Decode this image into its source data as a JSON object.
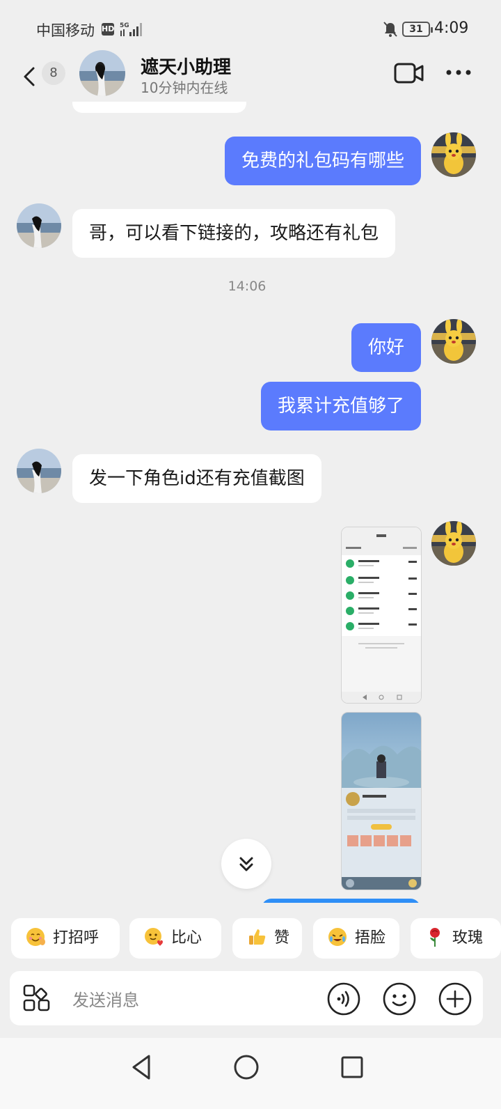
{
  "status_bar": {
    "carrier": "中国移动",
    "hd": "HD",
    "network": "5G",
    "battery": "31",
    "time": "4:09"
  },
  "header": {
    "unread_count": "8",
    "name": "遮天小助理",
    "online_status": "10分钟内在线"
  },
  "messages": [
    {
      "side": "out",
      "text": "免费的礼包码有哪些"
    },
    {
      "side": "in",
      "text": "哥，可以看下链接的，攻略还有礼包"
    },
    {
      "timestamp": "14:06"
    },
    {
      "side": "out",
      "text": "你好"
    },
    {
      "side": "out",
      "text": "我累计充值够了"
    },
    {
      "side": "in",
      "text": "发一下角色id还有充值截图"
    },
    {
      "side": "out",
      "type": "image",
      "content": "payment-records-screenshot"
    },
    {
      "side": "out",
      "type": "image",
      "content": "game-character-screenshot"
    }
  ],
  "quick_replies": [
    {
      "label": "打招呼",
      "icon": "greeting-emoji-icon"
    },
    {
      "label": "比心",
      "icon": "heart-hands-emoji-icon"
    },
    {
      "label": "赞",
      "icon": "thumbs-up-emoji-icon"
    },
    {
      "label": "捂脸",
      "icon": "facepalm-emoji-icon"
    },
    {
      "label": "玫瑰",
      "icon": "rose-emoji-icon"
    }
  ],
  "input": {
    "placeholder": "发送消息"
  },
  "colors": {
    "outgoing_bubble": "#5b7bfd",
    "incoming_bubble": "#ffffff",
    "background": "#efefef"
  }
}
